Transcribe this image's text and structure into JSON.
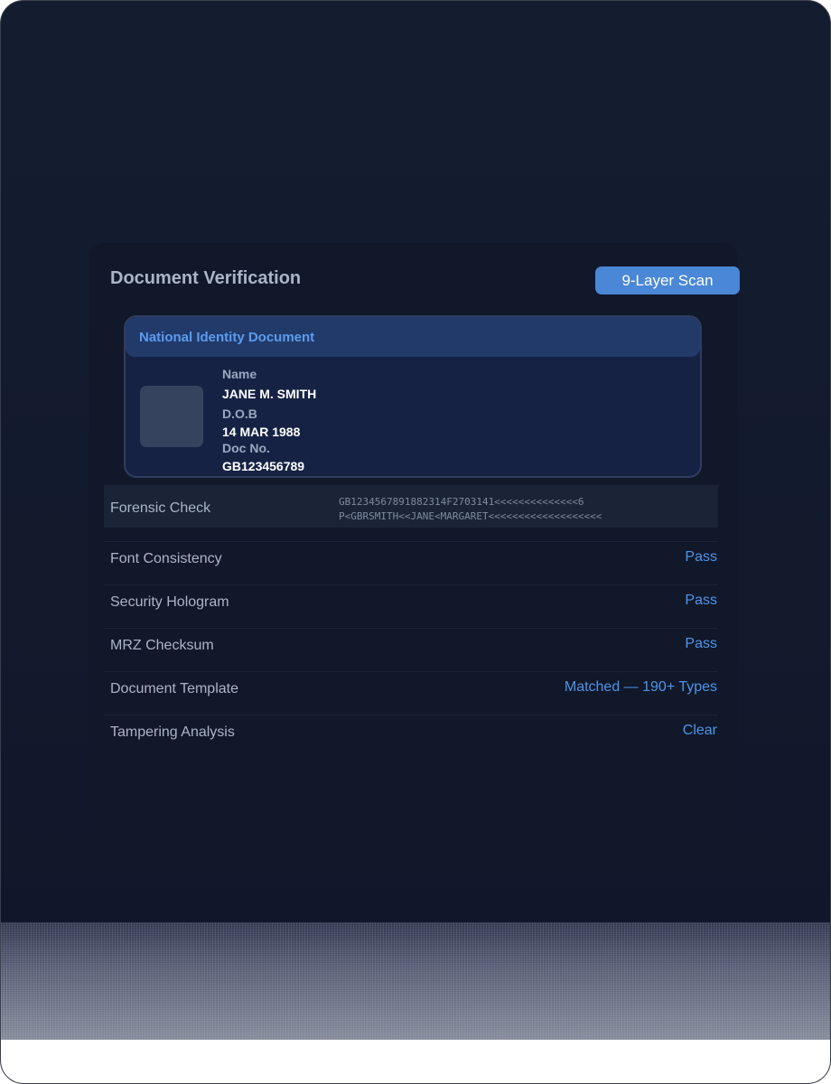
{
  "panel": {
    "title": "Document Verification",
    "scan_badge": "9-Layer Scan"
  },
  "id_card": {
    "header": "National Identity Document",
    "fields": [
      {
        "label": "Name",
        "value": "JANE M. SMITH"
      },
      {
        "label": "D.O.B",
        "value": "14 MAR 1988"
      },
      {
        "label": "Doc No.",
        "value": "GB123456789"
      }
    ]
  },
  "forensic": {
    "label": "Forensic Check",
    "mrz_line1": "GB1234567891882314F2703141<<<<<<<<<<<<<<6",
    "mrz_line2": "P<GBRSMITH<<JANE<MARGARET<<<<<<<<<<<<<<<<<<<"
  },
  "checks": [
    {
      "label": "Font Consistency",
      "value": "Pass"
    },
    {
      "label": "Security Hologram",
      "value": "Pass"
    },
    {
      "label": "MRZ Checksum",
      "value": "Pass"
    },
    {
      "label": "Document Template",
      "value": "Matched — 190+ Types"
    },
    {
      "label": "Tampering Analysis",
      "value": "Clear"
    }
  ],
  "colors": {
    "accent": "#4a87d6",
    "pass_text": "#4e95ea",
    "background": "#131b2e"
  }
}
